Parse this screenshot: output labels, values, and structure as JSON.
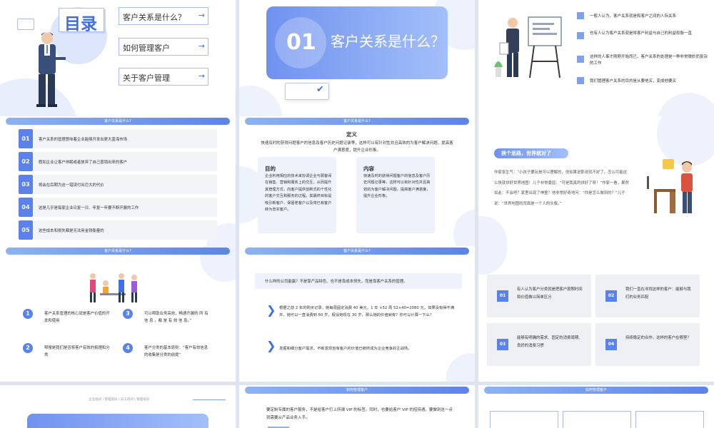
{
  "s1": {
    "title": "目录",
    "items": [
      "客户关系是什么？",
      "如何管理客户",
      "关于客户管理"
    ],
    "arrow": "→"
  },
  "s2": {
    "num": "01",
    "title": "客户关系是什么？"
  },
  "s3": {
    "points": [
      "一般人认为，客户关系就是和客户之间的人际关系",
      "也有人认为客户关系就是将客户利益与自己的利益权衡一直",
      "这样的人事才刚刚开始而已，客户关系的处理是一种非常微妙而复杂的工作",
      "我们管理客户关系的目的是从要他买，变成他要买"
    ]
  },
  "s4": {
    "header": "客户关系是什么?",
    "items": [
      {
        "n": "01",
        "text": "客户关系的管理意味着企业能够开发出更大蓝海市场"
      },
      {
        "n": "02",
        "text": "假如企业让客户休眠或者放弃了自己曾销出来的客户"
      },
      {
        "n": "03",
        "text": "将会在后期为这一错误付出巨大的代价"
      },
      {
        "n": "04",
        "text": "这是几乎是每家企业日复一日、年复一年要不断开展的工作"
      },
      {
        "n": "05",
        "text": "这些成本和损失都是无法用金钱衡量的"
      }
    ]
  },
  "s5": {
    "header": "客户关系是什么?",
    "def_title": "定义",
    "def_text": "快速及时的获得问题客户的信息及客户历史问题记录等，这样可以有针对性并且高效的为客户解决问题，提高客户满意度，提升企业形象。",
    "left_title": "目的",
    "left_text": "企业利用相应的技术来协调企业与顾客间在销售、营销和服务上的交互，从而提升其管理方式，向客户提供创新式的个性化的客户交互和服务的过程。其最终目标是吸引新客户、保留老客户以及将已有客户转为忠实客户。",
    "right_title": "内容",
    "right_text": "快速及时的获得问题客户的信息及客户历史问题记录等，这样可以有针对性并且高效的为客户解决问题，提高客户满意度，提升企业形象。"
  },
  "s6": {
    "badge": "换个思路，世界就对了",
    "text": "作家张生气：“小孩子要玩是可以理解的，但如果说那说就不好了。怎么可能这么快就拼好世界地图！儿子非常委屈：“可是我真的拼好了呀！”作家一看，果然如此：不会吧？家里出现了神童？他非常好奇地问：“你是怎么做到的？”儿子说：“世界地图的背面是一个人的头像。”"
  },
  "s7": {
    "header": "客户关系是什么?",
    "items": [
      {
        "n": "1",
        "text": "客户关系管理的核心就是客户价值的开发和使用"
      },
      {
        "n": "3",
        "text": "可以帮助业务高效，畅通开展的 所 有 信 息 ，都 是 有 效 信 息。”"
      },
      {
        "n": "2",
        "text": "帮搜是我们是否将客户有效的梳理和分类"
      },
      {
        "n": "4",
        "text": "客户分类的基本原则：“客户有效信息的收集是分类的前提”"
      }
    ]
  },
  "s8": {
    "header": "客户关系是什么?",
    "q": "什么样的公司能赢？不是靠产品特色、也不是靠成本领先，而是靠客户关系的管理。",
    "p1": "根据之前 2 年的购买记录，她每周固定消费 40 美元，1 年 ×52 周 52×40=2080 元，如果没有得不满并，她可以一直消费到 60 岁，假设她现在 30 岁，那么她的价值就有？你可以计算一下么？",
    "p2": "发掘和细分客户需求，不断发现自有客户的价值已被终成为企业竞争的主战场。"
  },
  "s9": {
    "items": [
      {
        "n": "01",
        "text": "有人认为客户分类就是把客户按照时间和价值做以简单区分"
      },
      {
        "n": "02",
        "text": "我们一直在寻找这样的客户：能够与我们的业务匹配"
      },
      {
        "n": "03",
        "text": "能够有明确的需求、固定的消费周期、良好的消费习惯"
      },
      {
        "n": "04",
        "text": "持续稳定的合作。这样的客户在哪里？"
      }
    ]
  },
  "s10": {
    "crumbs": "企业培训 \\ 管理培训 \\ 员工培训 \\ 管理培训"
  },
  "s11": {
    "header": "如何管理客户",
    "text": "要定制专属的客户服务，不是给客户打上所谓 VIP 的标签。同时，也要给客户 VIP 的招待遇。要做到这一点就需要从产品业务入手。"
  },
  "s12": {
    "header": "如何管理客户"
  }
}
